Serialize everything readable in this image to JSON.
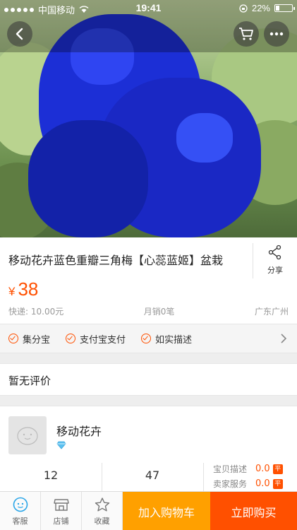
{
  "status_bar": {
    "carrier": "中国移动",
    "time": "19:41",
    "battery": "22%"
  },
  "product": {
    "title": "移动花卉蓝色重瓣三角梅【心蕊蓝姬】盆栽",
    "currency": "¥",
    "price": "38",
    "shipping": "快递: 10.00元",
    "monthly_sales": "月销0笔",
    "location": "广东广州",
    "share_label": "分享"
  },
  "services": [
    {
      "label": "集分宝"
    },
    {
      "label": "支付宝支付"
    },
    {
      "label": "如实描述"
    }
  ],
  "reviews": {
    "label": "暂无评价"
  },
  "shop": {
    "name": "移动花卉",
    "stat1": "12",
    "stat2": "47",
    "ratings": [
      {
        "label": "宝贝描述",
        "value": "0.0",
        "tag": "平"
      },
      {
        "label": "卖家服务",
        "value": "0.0",
        "tag": "平"
      }
    ]
  },
  "bottom_bar": {
    "service_label": "客服",
    "store_label": "店铺",
    "favorite_label": "收藏",
    "add_to_cart": "加入购物车",
    "buy_now": "立即购买"
  },
  "colors": {
    "accent": "#ff5000",
    "cart_button": "#ffa000",
    "flower": "#1a2fd8"
  }
}
